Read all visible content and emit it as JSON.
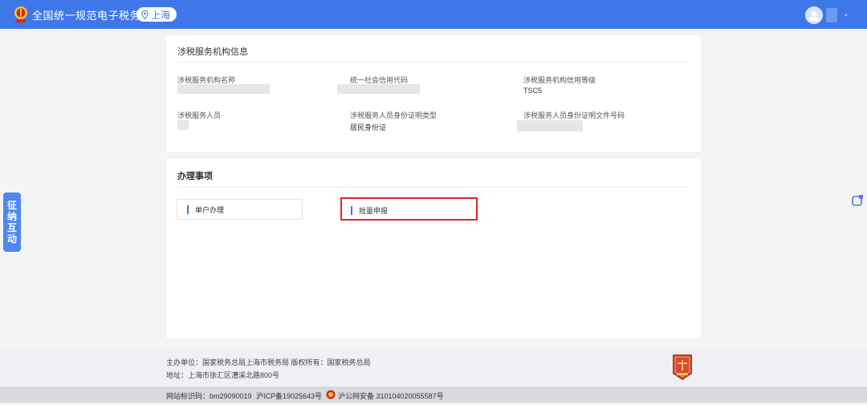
{
  "header": {
    "site_title": "全国统一规范电子税务局",
    "region": "上海",
    "user_caret": "⌄"
  },
  "side_tab": {
    "chars": [
      "征",
      "纳",
      "互",
      "动"
    ]
  },
  "info_card": {
    "title": "涉税服务机构信息",
    "fields": [
      {
        "label": "涉税服务机构名称",
        "value": ""
      },
      {
        "label": "统一社会信用代码",
        "value": ""
      },
      {
        "label": "涉税服务机构信用等级",
        "value": "TSC5"
      },
      {
        "label": "涉税服务人员",
        "value": ""
      },
      {
        "label": "涉税服务人员身份证明类型",
        "value": "居民身份证"
      },
      {
        "label": "涉税服务人员身份证明文件号码",
        "value": ""
      }
    ]
  },
  "items_card": {
    "title": "办理事项",
    "items": [
      {
        "label": "单户办理"
      },
      {
        "label": "批量申报"
      }
    ]
  },
  "footer": {
    "line1": "主办单位：国家税务总局上海市税务局    版权所有：国家税务总局",
    "line2": "地址：上海市徐汇区漕溪北路800号",
    "site_code": "网站标识码：bm29090019",
    "icp": "沪ICP备19025643号",
    "police": "沪公网安备 310104020055587号"
  },
  "colors": {
    "brand_blue": "#3e78e8",
    "highlight_red": "#e0242b"
  }
}
